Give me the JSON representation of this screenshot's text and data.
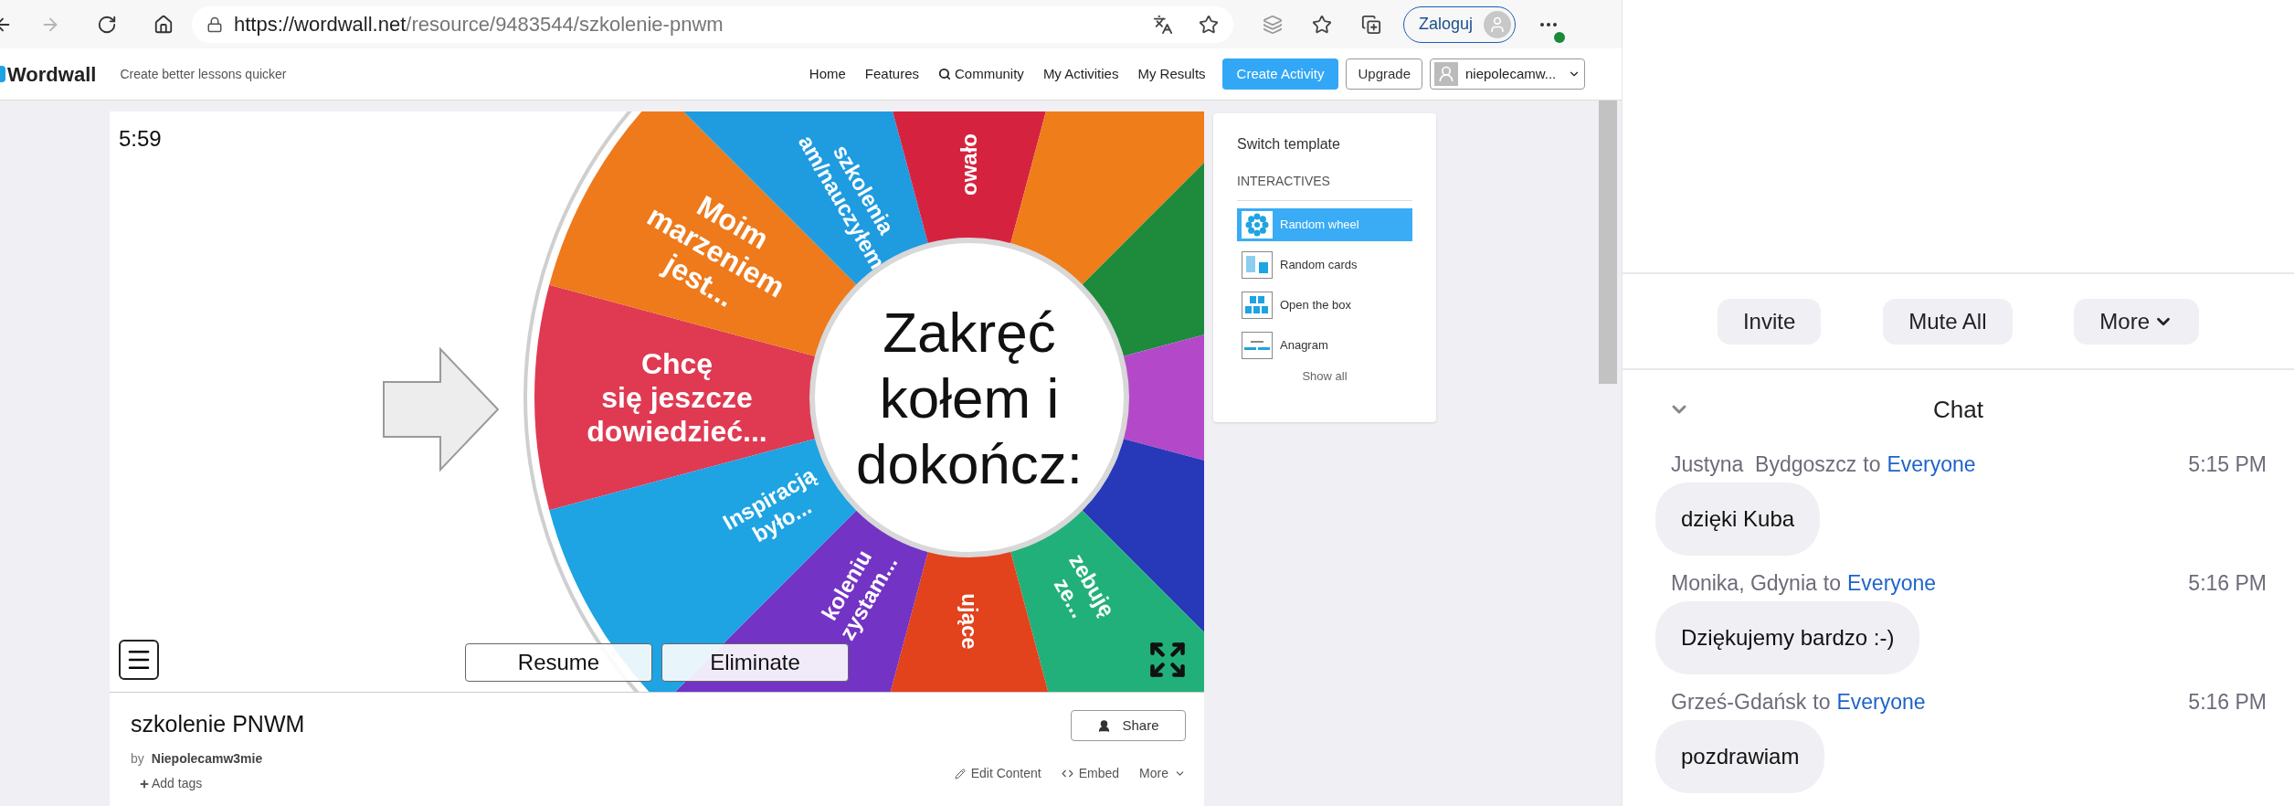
{
  "browser": {
    "back": {
      "disabled": false
    },
    "forward": {
      "disabled": true
    },
    "url": {
      "host": "https://wordwall.net",
      "path": "/resource/9483544/szkolenie-pnwm"
    },
    "sign_in": "Zaloguj"
  },
  "site_header": {
    "logo": "Wordwall",
    "tagline": "Create better lessons quicker",
    "nav": [
      {
        "label": "Home",
        "kind": "link"
      },
      {
        "label": "Features",
        "kind": "link"
      },
      {
        "label": "Community",
        "kind": "search"
      },
      {
        "label": "My Activities",
        "kind": "link"
      },
      {
        "label": "My Results",
        "kind": "link"
      },
      {
        "label": "Create Activity",
        "kind": "primary"
      },
      {
        "label": "Upgrade",
        "kind": "outline"
      }
    ],
    "user": "niepolecamw..."
  },
  "game": {
    "timer": "5:59",
    "center_lines": [
      "Zakręć",
      "kołem i",
      "dokończ:"
    ],
    "segments": [
      {
        "color": "#e03a52",
        "lines": [
          "Chcę",
          "się jeszcze",
          "dowiedzieć..."
        ]
      },
      {
        "color": "#ee7a1c",
        "lines": [
          "Moim",
          "marzeniem",
          "jest..."
        ]
      },
      {
        "color": "#1f9be0",
        "lines": [
          "szkolenia",
          "am/nauczyłem"
        ]
      },
      {
        "color": "#d5233f",
        "lines": [
          "owało"
        ]
      },
      {
        "color": "#ee7d1a"
      },
      {
        "color": "#1d8a3c"
      },
      {
        "color": "#b349c9"
      },
      {
        "color": "#2738b8"
      },
      {
        "color": "#22b07a",
        "lines": [
          "zebuję",
          "ze..."
        ]
      },
      {
        "color": "#e2421c",
        "lines": [
          "ujące"
        ]
      },
      {
        "color": "#7333c4",
        "lines": [
          "koleniu",
          "zystam..."
        ]
      },
      {
        "color": "#1ea3e3",
        "lines": [
          "Inspiracją",
          "było..."
        ]
      }
    ],
    "buttons": [
      "Resume",
      "Eliminate"
    ]
  },
  "sidebar": {
    "title": "Switch template",
    "section": "INTERACTIVES",
    "templates": [
      {
        "label": "Random wheel",
        "kind": "wheel",
        "selected": true
      },
      {
        "label": "Random cards",
        "kind": "cards",
        "selected": false
      },
      {
        "label": "Open the box",
        "kind": "box",
        "selected": false
      },
      {
        "label": "Anagram",
        "kind": "anagram",
        "selected": false
      }
    ],
    "show_all": "Show all"
  },
  "activity": {
    "title": "szkolenie PNWM",
    "by_label": "by",
    "author": "Niepolecamw3mie",
    "add_tags": "Add tags",
    "share": "Share",
    "actions": [
      {
        "label": "Edit Content",
        "kind": "edit"
      },
      {
        "label": "Embed",
        "kind": "embed"
      },
      {
        "label": "More",
        "kind": "more"
      }
    ]
  },
  "meeting": {
    "buttons": [
      {
        "label": "Invite",
        "kind": "plain"
      },
      {
        "label": "Mute All",
        "kind": "plain"
      },
      {
        "label": "More",
        "kind": "menu"
      }
    ],
    "chat": {
      "title": "Chat",
      "expanded": true,
      "messages": [
        {
          "sender": "Justyna  Bydgoszcz",
          "to_label": "to",
          "recipient": "Everyone",
          "time": "5:15 PM",
          "text": "dzięki Kuba"
        },
        {
          "sender": "Monika, Gdynia",
          "to_label": "to",
          "recipient": "Everyone",
          "time": "5:16 PM",
          "text": "Dziękujemy bardzo :-)"
        },
        {
          "sender": "Grześ-Gdańsk",
          "to_label": "to",
          "recipient": "Everyone",
          "time": "5:16 PM",
          "text": "pozdrawiam"
        }
      ]
    }
  }
}
